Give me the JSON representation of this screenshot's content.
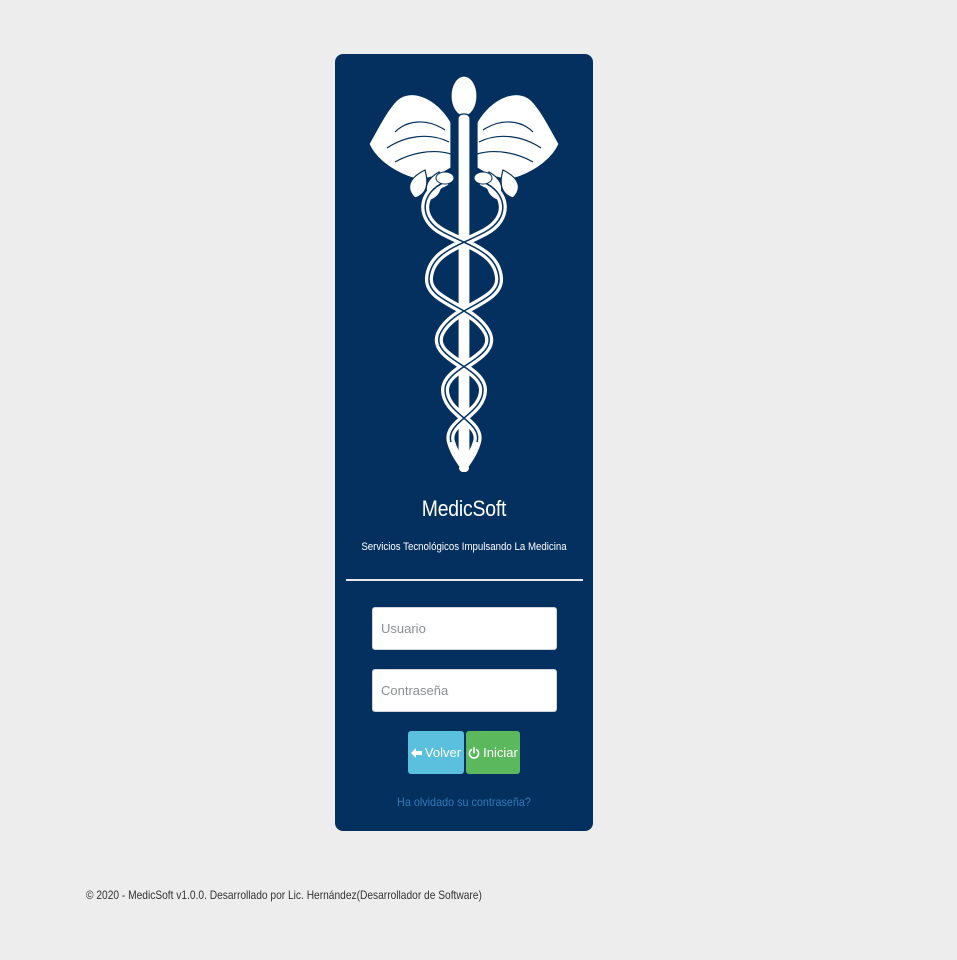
{
  "brand": {
    "title": "MedicSoft",
    "tagline": "Servicios Tecnológicos Impulsando La Medicina",
    "logo_icon": "caduceus-icon"
  },
  "login": {
    "username_placeholder": "Usuario",
    "password_placeholder": "Contraseña",
    "back_label": "Volver",
    "back_icon": "arrow-left-icon",
    "start_label": "Iniciar",
    "start_icon": "power-icon",
    "forgot_link": "Ha olvidado su contraseña?"
  },
  "footer": {
    "text": "© 2020 - MedicSoft v1.0.0. Desarrollado por Lic. Hernández(Desarrollador de Software)"
  },
  "colors": {
    "page_bg": "#ededed",
    "card_bg": "#04305f",
    "back_button": "#5bc0de",
    "start_button": "#5cb85c",
    "link": "#337ab7"
  }
}
